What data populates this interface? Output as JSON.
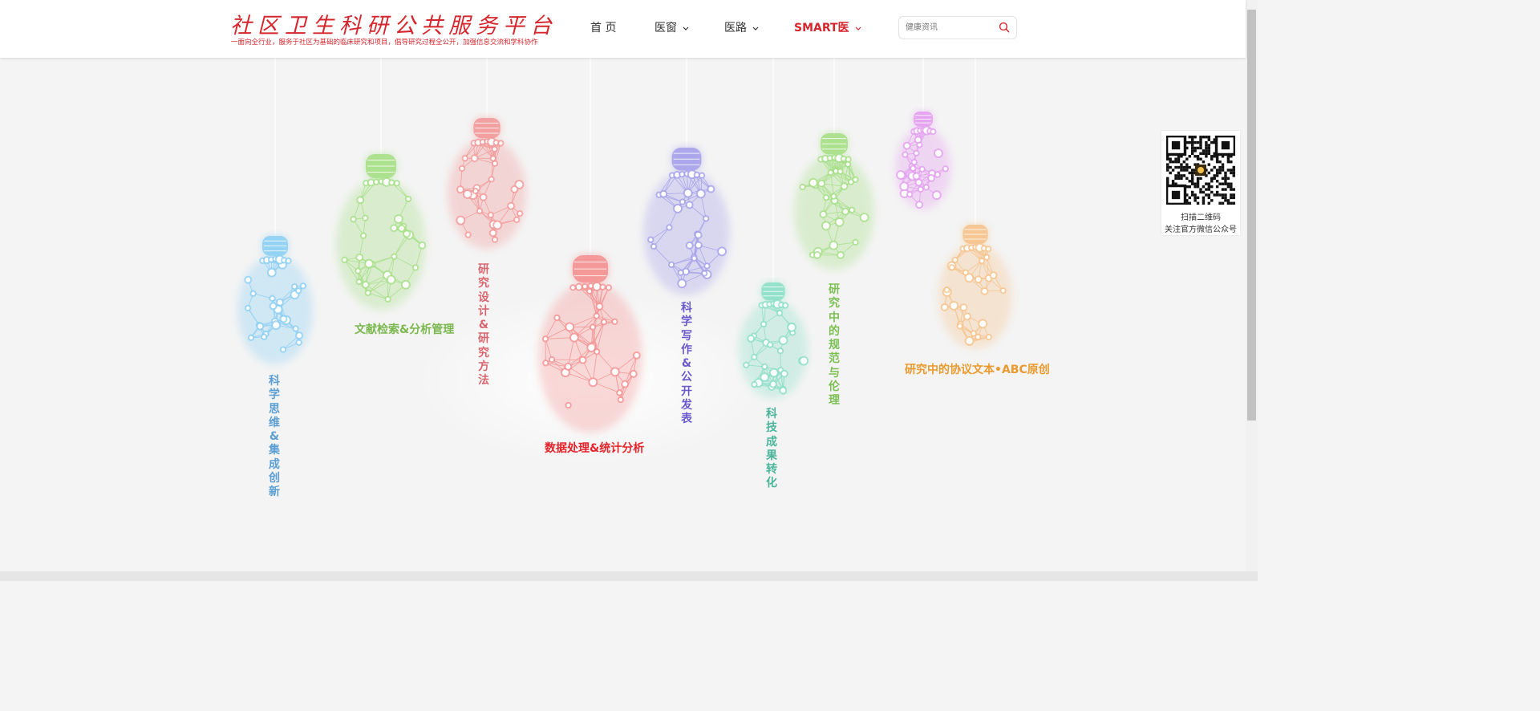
{
  "header": {
    "logo_title": "社区卫生科研公共服务平台",
    "logo_subtitle": "一面向全行业，服务于社区为基础的临床研究和项目，倡导研究过程全公开，加强信息交流和学科协作",
    "nav": [
      "首 页",
      "医窗",
      "医路",
      "SMART医"
    ],
    "search_placeholder": "健康资讯"
  },
  "bulbs": [
    {
      "label": "科学思维&集成创新",
      "color": "#5b9fd4"
    },
    {
      "label": "文献检索&分析管理",
      "color": "#7ab84e"
    },
    {
      "label": "研究设计&研究方法",
      "color": "#d9666f"
    },
    {
      "label": "数据处理&统计分析",
      "color": "#e6232a"
    },
    {
      "label": "科学写作&公开发表",
      "color": "#6a5acd"
    },
    {
      "label": "科技成果转化",
      "color": "#4bb59b"
    },
    {
      "label": "研究中的规范与伦理",
      "color": "#7cbf52"
    },
    {
      "label": "研究中的协议文本•ABC原创",
      "color": "#eb9a2e"
    }
  ],
  "qr": {
    "line1": "扫描二维码",
    "line2": "关注官方微信公众号"
  },
  "colors": {
    "brand_red": "#d6262d"
  }
}
